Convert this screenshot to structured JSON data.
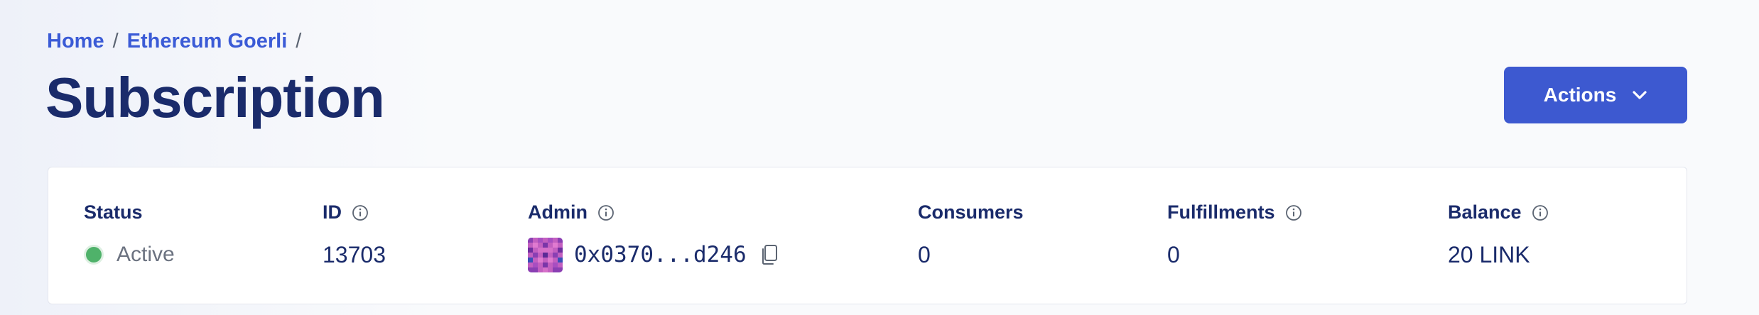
{
  "breadcrumb": {
    "home": "Home",
    "network": "Ethereum Goerli",
    "separator": "/"
  },
  "page": {
    "title": "Subscription"
  },
  "actions": {
    "label": "Actions",
    "icon": "chevron-down-icon"
  },
  "details": {
    "status": {
      "label": "Status",
      "value": "Active",
      "color": "#4fb26a"
    },
    "id": {
      "label": "ID",
      "value": "13703"
    },
    "admin": {
      "label": "Admin",
      "value": "0x0370...d246"
    },
    "consumers": {
      "label": "Consumers",
      "value": "0"
    },
    "fulfillments": {
      "label": "Fulfillments",
      "value": "0"
    },
    "balance": {
      "label": "Balance",
      "value": "20 LINK"
    }
  },
  "colors": {
    "accent": "#3d59d0",
    "link": "#3b5bd6",
    "heading": "#1a2b6b"
  }
}
